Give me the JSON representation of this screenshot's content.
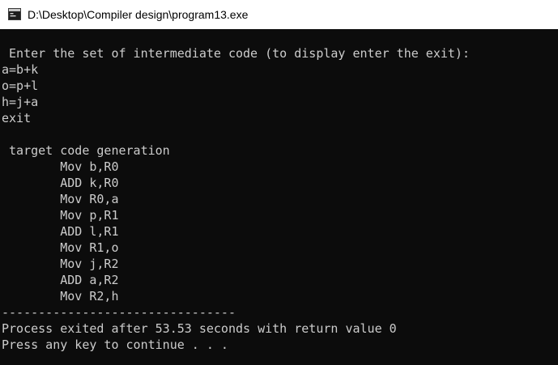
{
  "window": {
    "title": "D:\\Desktop\\Compiler design\\program13.exe",
    "icon": "console-app-icon"
  },
  "colors": {
    "console_background": "#0c0c0c",
    "console_text": "#cccccc",
    "titlebar_background": "#ffffff"
  },
  "console": {
    "lines": [
      " Enter the set of intermediate code (to display enter the exit):",
      "a=b+k",
      "o=p+l",
      "h=j+a",
      "exit",
      "",
      " target code generation",
      "        Mov b,R0",
      "        ADD k,R0",
      "        Mov R0,a",
      "        Mov p,R1",
      "        ADD l,R1",
      "        Mov R1,o",
      "        Mov j,R2",
      "        ADD a,R2",
      "        Mov R2,h",
      "--------------------------------",
      "Process exited after 53.53 seconds with return value 0",
      "Press any key to continue . . ."
    ]
  }
}
